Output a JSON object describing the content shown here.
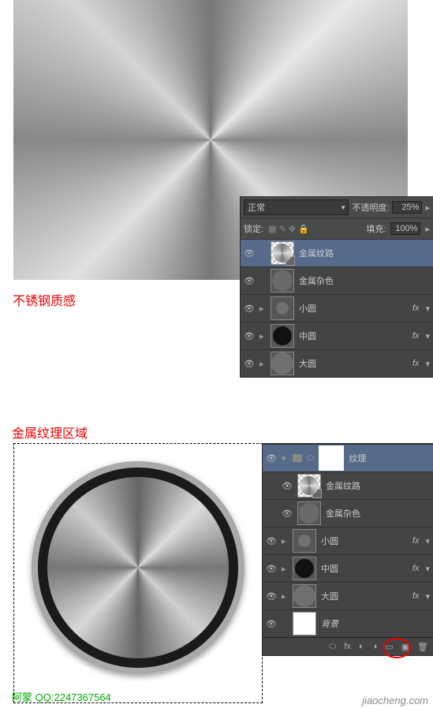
{
  "captions": {
    "steel": "不锈钢质感",
    "region": "金属纹理区域"
  },
  "author": {
    "name": "阿蒙",
    "qq_label": "QQ:",
    "qq": "2247367564"
  },
  "watermark": "jiaocheng.com",
  "panel1": {
    "blend_mode": "正常",
    "opacity_label": "不透明度:",
    "opacity_value": "25%",
    "lock_label": "锁定:",
    "fill_label": "填充:",
    "fill_value": "100%",
    "layers": [
      {
        "name": "金属纹路",
        "fx": false,
        "thumb": "transp",
        "selected": true,
        "badge": true
      },
      {
        "name": "金属杂色",
        "fx": false,
        "thumb": "gray"
      },
      {
        "name": "小圆",
        "fx": true,
        "thumb": "small"
      },
      {
        "name": "中圆",
        "fx": true,
        "thumb": "mid"
      },
      {
        "name": "大圆",
        "fx": true,
        "thumb": "big"
      }
    ]
  },
  "panel2": {
    "group_name": "纹理",
    "layers": [
      {
        "name": "金属纹路",
        "fx": false,
        "thumb": "transp",
        "badge": true
      },
      {
        "name": "金属杂色",
        "fx": false,
        "thumb": "gray"
      },
      {
        "name": "小圆",
        "fx": true,
        "thumb": "small"
      },
      {
        "name": "中圆",
        "fx": true,
        "thumb": "mid"
      },
      {
        "name": "大圆",
        "fx": true,
        "thumb": "big"
      },
      {
        "name": "背景",
        "fx": false,
        "thumb": "white",
        "italic": true
      }
    ]
  },
  "fx_label": "fx"
}
